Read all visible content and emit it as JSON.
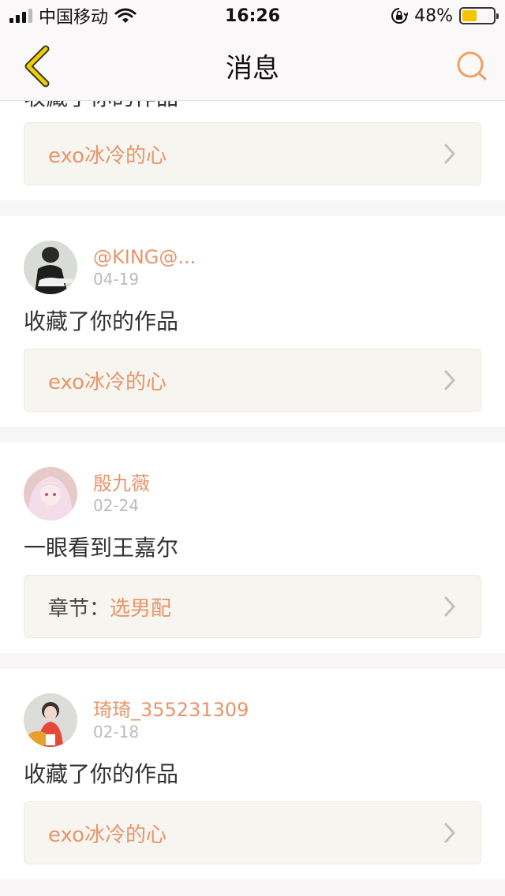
{
  "status_bar": {
    "carrier": "中国移动",
    "time": "16:26",
    "battery_percent_text": "48%",
    "battery_level": 0.48
  },
  "nav": {
    "title": "消息",
    "back_icon": "chevron-left-icon",
    "search_icon": "search-icon"
  },
  "colors": {
    "accent": "#e8956a",
    "back_arrow": "#e8c800",
    "search": "#f0a060",
    "battery": "#f5c400"
  },
  "notifications": [
    {
      "message": "收藏了你的作品",
      "work_label": "",
      "work_title": "exo冰冷的心"
    },
    {
      "username": "@KING@...",
      "date": "04-19",
      "message": "收藏了你的作品",
      "work_label": "",
      "work_title": "exo冰冷的心"
    },
    {
      "username": "殷九薇",
      "date": "02-24",
      "message": "一眼看到王嘉尔",
      "work_label": "章节：",
      "work_title": "选男配"
    },
    {
      "username": "琦琦_355231309",
      "date": "02-18",
      "message": "收藏了你的作品",
      "work_label": "",
      "work_title": "exo冰冷的心"
    }
  ]
}
